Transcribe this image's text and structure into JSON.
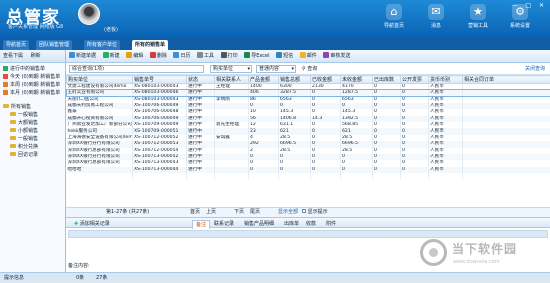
{
  "header": {
    "app_title": "总管家",
    "subtitle": "客户关系管理 网络版 G8",
    "user_name": "(老板)",
    "nav": [
      {
        "label": "导航首页",
        "glyph": "⌂"
      },
      {
        "label": "消息",
        "glyph": "✉"
      },
      {
        "label": "营销工具",
        "glyph": "★"
      },
      {
        "label": "系统设置",
        "glyph": "⚙"
      }
    ],
    "window_controls": "— □ ✕"
  },
  "tabs": [
    "导航首页",
    "团队销售管理",
    "所有客户单位",
    "所有的销售单"
  ],
  "sidebar": {
    "toolbar": [
      "查看下属",
      "刷新"
    ],
    "summary": [
      {
        "label": "进行中的销售单",
        "color": "#27ae60"
      },
      {
        "label": "今天 (0)到期 新销售单",
        "color": "#e74c3c"
      },
      {
        "label": "本周 (0)到期 新销售单",
        "color": "#e67e22"
      },
      {
        "label": "本月 (0)到期 新销售单",
        "color": "#e67e22"
      }
    ],
    "tree_root": "所有销售",
    "tree_items": [
      "一般销售",
      "大额销售",
      "小额销售",
      "一般销售",
      "积分兑换",
      "回访记录"
    ]
  },
  "toolbar": [
    "新建单据",
    "新建",
    "编辑",
    "删除",
    "日历",
    "工具",
    "打印",
    "导Excel",
    "短信",
    "邮件",
    "审核发送"
  ],
  "search": {
    "placeholder": "综合查询(1项)",
    "field1": "购买单位",
    "field2": "普通内容",
    "query_label": "查询",
    "close_label": "关闭查询"
  },
  "table": {
    "columns": [
      "购买单位",
      "销售单号",
      "状态",
      "相关联系人",
      "产品金额",
      "销售总额",
      "已收金额",
      "未收金额",
      "已出库数",
      "公开发票",
      "货币币别",
      "相关合同订单"
    ],
    "rows": [
      [
        "文建工程建设有限公司demo",
        "XS-080103-000043",
        "进行中",
        "王经理",
        "1400",
        "6300",
        "2130",
        "4170",
        "0",
        "0",
        "人民币",
        ""
      ],
      [
        "王府实业有限公司",
        "XS-080103-000046",
        "进行中",
        "",
        "406",
        "3287.5",
        "0",
        "1287.5",
        "0",
        "0",
        "人民币",
        ""
      ],
      [
        "天丽(仁)医公司",
        "XS-080103-000043",
        "进行中",
        "李晴雨",
        "86",
        "6563",
        "0",
        "6563",
        "0",
        "0",
        "人民币",
        ""
      ],
      [
        "成都天利贸易工程公司",
        "XS-100706-000049",
        "进行中",
        "",
        "0",
        "0",
        "0",
        "0",
        "0",
        "0",
        "人民币",
        ""
      ],
      [
        "鑫泰",
        "XS-100706-000048",
        "进行中",
        "",
        "10",
        "145.3",
        "0",
        "145.3",
        "0",
        "0",
        "人民币",
        ""
      ],
      [
        "成都开心投资有限公司",
        "XS-100706-000049",
        "进行中",
        "",
        "56",
        "1406.8",
        "14.3",
        "1392.5",
        "0",
        "0",
        "人民币",
        ""
      ],
      [
        "广州新业发达加工厂新部分公司demo",
        "XS-100709-000049",
        "进行中",
        "袁先生经理",
        "12",
        "631.1",
        "0",
        "568.85",
        "0",
        "0",
        "人民币",
        ""
      ],
      [
        "hekk服务公司",
        "XS-100709-000051",
        "进行中",
        "",
        "23",
        "621",
        "0",
        "621",
        "0",
        "0",
        "人民币",
        ""
      ],
      [
        "上海海德安全设备有限公司demo",
        "XS-100712-000052",
        "进行中",
        "安琪露",
        "4",
        "28.5",
        "0",
        "28.5",
        "0",
        "0",
        "人民币",
        ""
      ],
      [
        "深圳XX银行分行有限公司",
        "XS-100712-000053",
        "进行中",
        "",
        "292",
        "6696.5",
        "0",
        "6696.5",
        "0",
        "0",
        "人民币",
        ""
      ],
      [
        "深圳XX银行总部有限公司",
        "XS-100712-000054",
        "进行中",
        "",
        "2",
        "28.5",
        "0",
        "28.5",
        "0",
        "0",
        "人民币",
        ""
      ],
      [
        "深圳XX银行分行有限公司",
        "XS-100713-000052",
        "进行中",
        "",
        "0",
        "0",
        "0",
        "0",
        "0",
        "0",
        "人民币",
        ""
      ],
      [
        "深圳XX银行总部有限公司",
        "XS-100713-000043",
        "进行中",
        "",
        "0",
        "0",
        "0",
        "0",
        "0",
        "0",
        "人民币",
        ""
      ],
      [
        "哈哈哈",
        "XS-100713-000044",
        "进行中",
        "",
        "0",
        "0",
        "0",
        "0",
        "0",
        "0",
        "人民币",
        ""
      ],
      [
        "",
        "",
        "",
        "",
        "",
        "",
        "",
        "",
        "",
        "",
        "",
        ""
      ]
    ],
    "selected_row": 1
  },
  "pager": {
    "info": "第1-27条 (共27条)",
    "first": "首页",
    "prev": "上页",
    "next": "下页",
    "last": "尾页",
    "show_all": "显示全部",
    "show_tip": "显示提示"
  },
  "bottom_tabs": {
    "add_label": "添加相关记录",
    "items": [
      "备注",
      "联系记录",
      "销售产品明细",
      "出库单",
      "收款",
      "附件"
    ],
    "active": "备注"
  },
  "remark_label": "备注内容:",
  "status": {
    "left": "提示信息",
    "mid1": "0条",
    "mid2": "27条"
  },
  "watermark": {
    "title": "当下软件园",
    "url": "www.downxia.com"
  }
}
